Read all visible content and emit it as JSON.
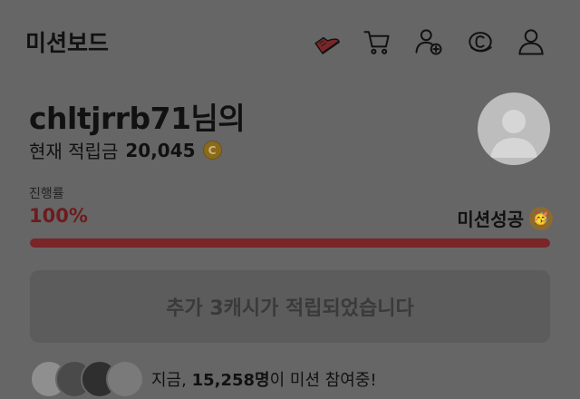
{
  "header": {
    "title": "미션보드",
    "icons": [
      "shoe-icon",
      "cart-icon",
      "add-user-icon",
      "coin-icon",
      "profile-icon"
    ]
  },
  "user": {
    "name": "chltjrrb71님의",
    "points_label": "현재 적립금",
    "points_value": "20,045",
    "coin_symbol": "C"
  },
  "progress": {
    "label": "진행률",
    "percent_text": "100%",
    "percent_value": 100,
    "success_text": "미션성공"
  },
  "message": "추가 3캐시가 적립되었습니다",
  "participants": {
    "prefix": "지금,",
    "count": "15,258명",
    "suffix": "이 미션 참여중!"
  },
  "colors": {
    "accent": "#7a2528",
    "percent_text": "#6e1b1e",
    "shoe": "#7a2528",
    "overlay": "#666666"
  }
}
